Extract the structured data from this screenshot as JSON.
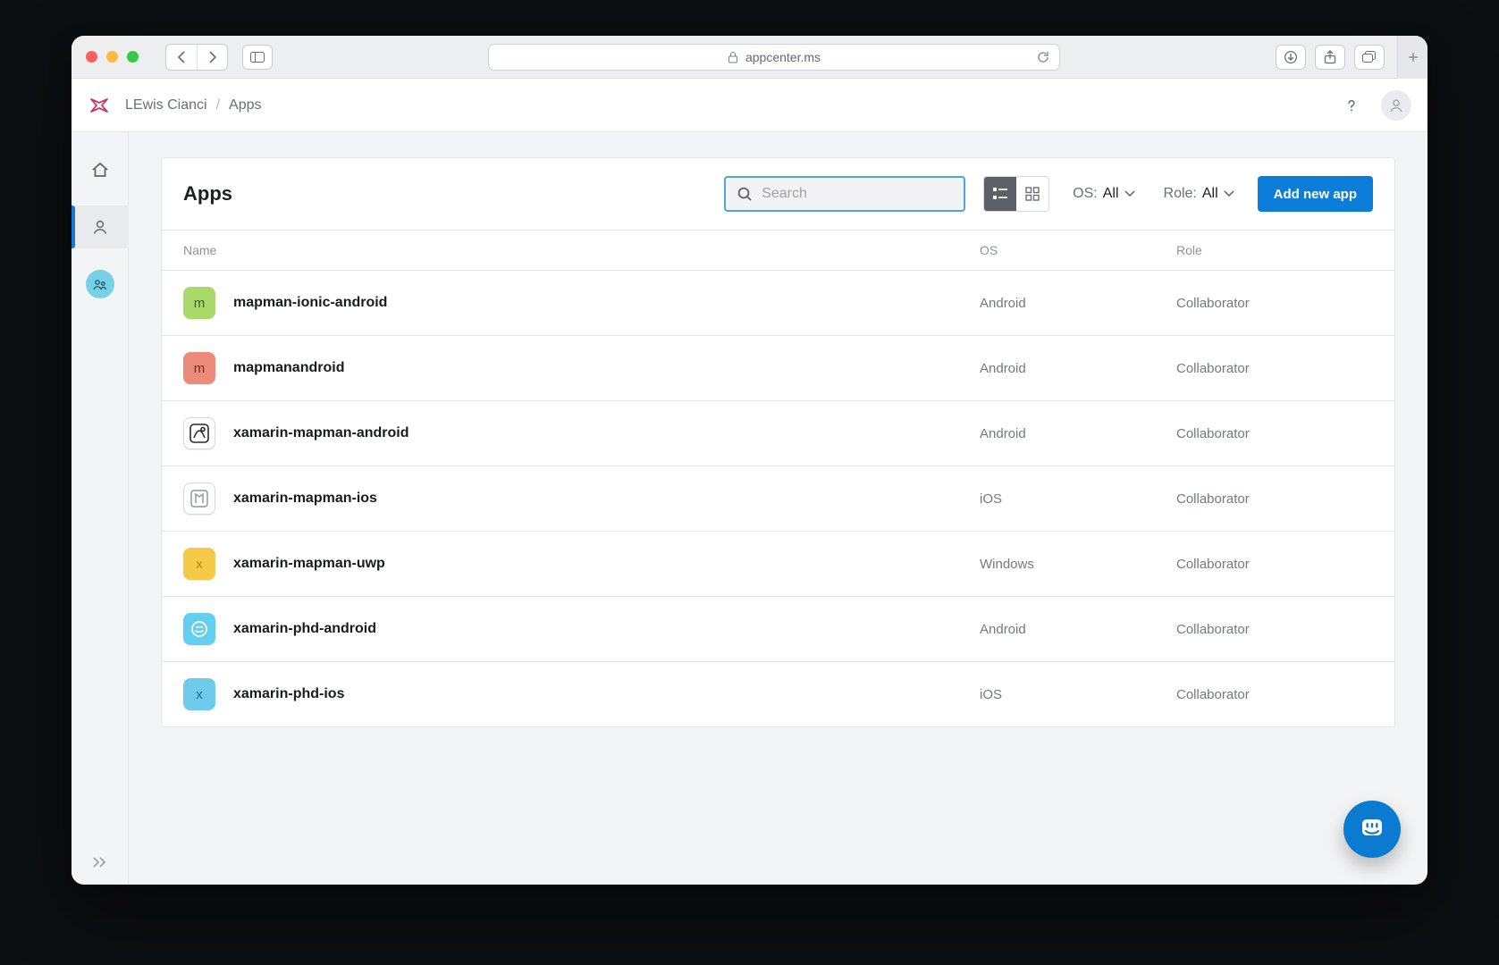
{
  "browser": {
    "url_display": "appcenter.ms"
  },
  "breadcrumb": {
    "user": "LEwis Cianci",
    "section": "Apps"
  },
  "panel": {
    "title": "Apps",
    "search_placeholder": "Search",
    "os_filter_label": "OS:",
    "os_filter_value": "All",
    "role_filter_label": "Role:",
    "role_filter_value": "All",
    "add_button": "Add new app"
  },
  "columns": {
    "name": "Name",
    "os": "OS",
    "role": "Role"
  },
  "apps": [
    {
      "name": "mapman-ionic-android",
      "os": "Android",
      "role": "Collaborator",
      "icon": "m1",
      "letter": "m"
    },
    {
      "name": "mapmanandroid",
      "os": "Android",
      "role": "Collaborator",
      "icon": "m2",
      "letter": "m"
    },
    {
      "name": "xamarin-mapman-android",
      "os": "Android",
      "role": "Collaborator",
      "icon": "map1",
      "letter": ""
    },
    {
      "name": "xamarin-mapman-ios",
      "os": "iOS",
      "role": "Collaborator",
      "icon": "map2",
      "letter": ""
    },
    {
      "name": "xamarin-mapman-uwp",
      "os": "Windows",
      "role": "Collaborator",
      "icon": "x1",
      "letter": "x"
    },
    {
      "name": "xamarin-phd-android",
      "os": "Android",
      "role": "Collaborator",
      "icon": "phd1",
      "letter": ""
    },
    {
      "name": "xamarin-phd-ios",
      "os": "iOS",
      "role": "Collaborator",
      "icon": "x2",
      "letter": "x"
    }
  ]
}
